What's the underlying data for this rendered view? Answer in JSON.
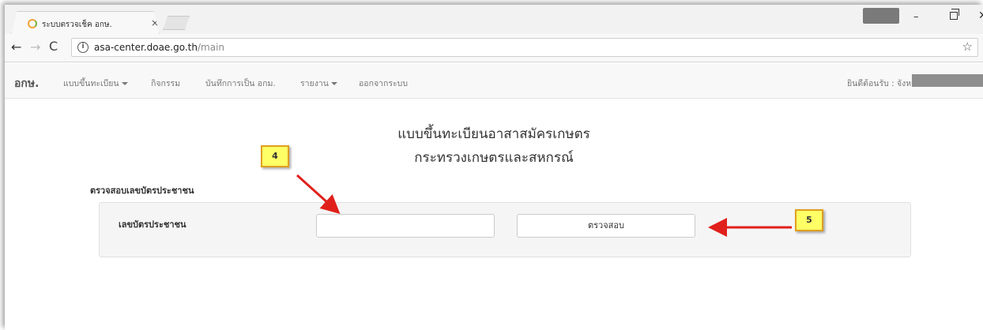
{
  "browser": {
    "tab_title": "ระบบตรวจเช็ค อกษ.",
    "tab_close": "×",
    "minimize": "–",
    "close": "✕",
    "url_host": "asa-center.doae.go.th",
    "url_path": "/main",
    "info_glyph": "i",
    "back_glyph": "←",
    "forward_glyph": "→",
    "reload_glyph": "C",
    "star_glyph": "☆"
  },
  "appnav": {
    "brand": "อกษ.",
    "items": [
      {
        "label": "แบบขึ้นทะเบียน",
        "dropdown": true
      },
      {
        "label": "กิจกรรม",
        "dropdown": false
      },
      {
        "label": "บันทึกการเป็น อกม.",
        "dropdown": false
      },
      {
        "label": "รายงาน",
        "dropdown": true
      },
      {
        "label": "ออกจากระบบ",
        "dropdown": false
      }
    ],
    "welcome": "ยินดีต้อนรับ : จังหวัด"
  },
  "main": {
    "title_line1": "แบบขึ้นทะเบียนอาสาสมัครเกษตร",
    "title_line2": "กระทรวงเกษตรและสหกรณ์",
    "section_label": "ตรวจสอบเลขบัตรประชาชน",
    "field_label": "เลขบัตรประชาชน",
    "id_value": "",
    "check_button": "ตรวจสอบ"
  },
  "annotations": {
    "callout_4": "4",
    "callout_5": "5",
    "arrow_color": "#e0201b",
    "callout_bg": "#ffff66"
  }
}
